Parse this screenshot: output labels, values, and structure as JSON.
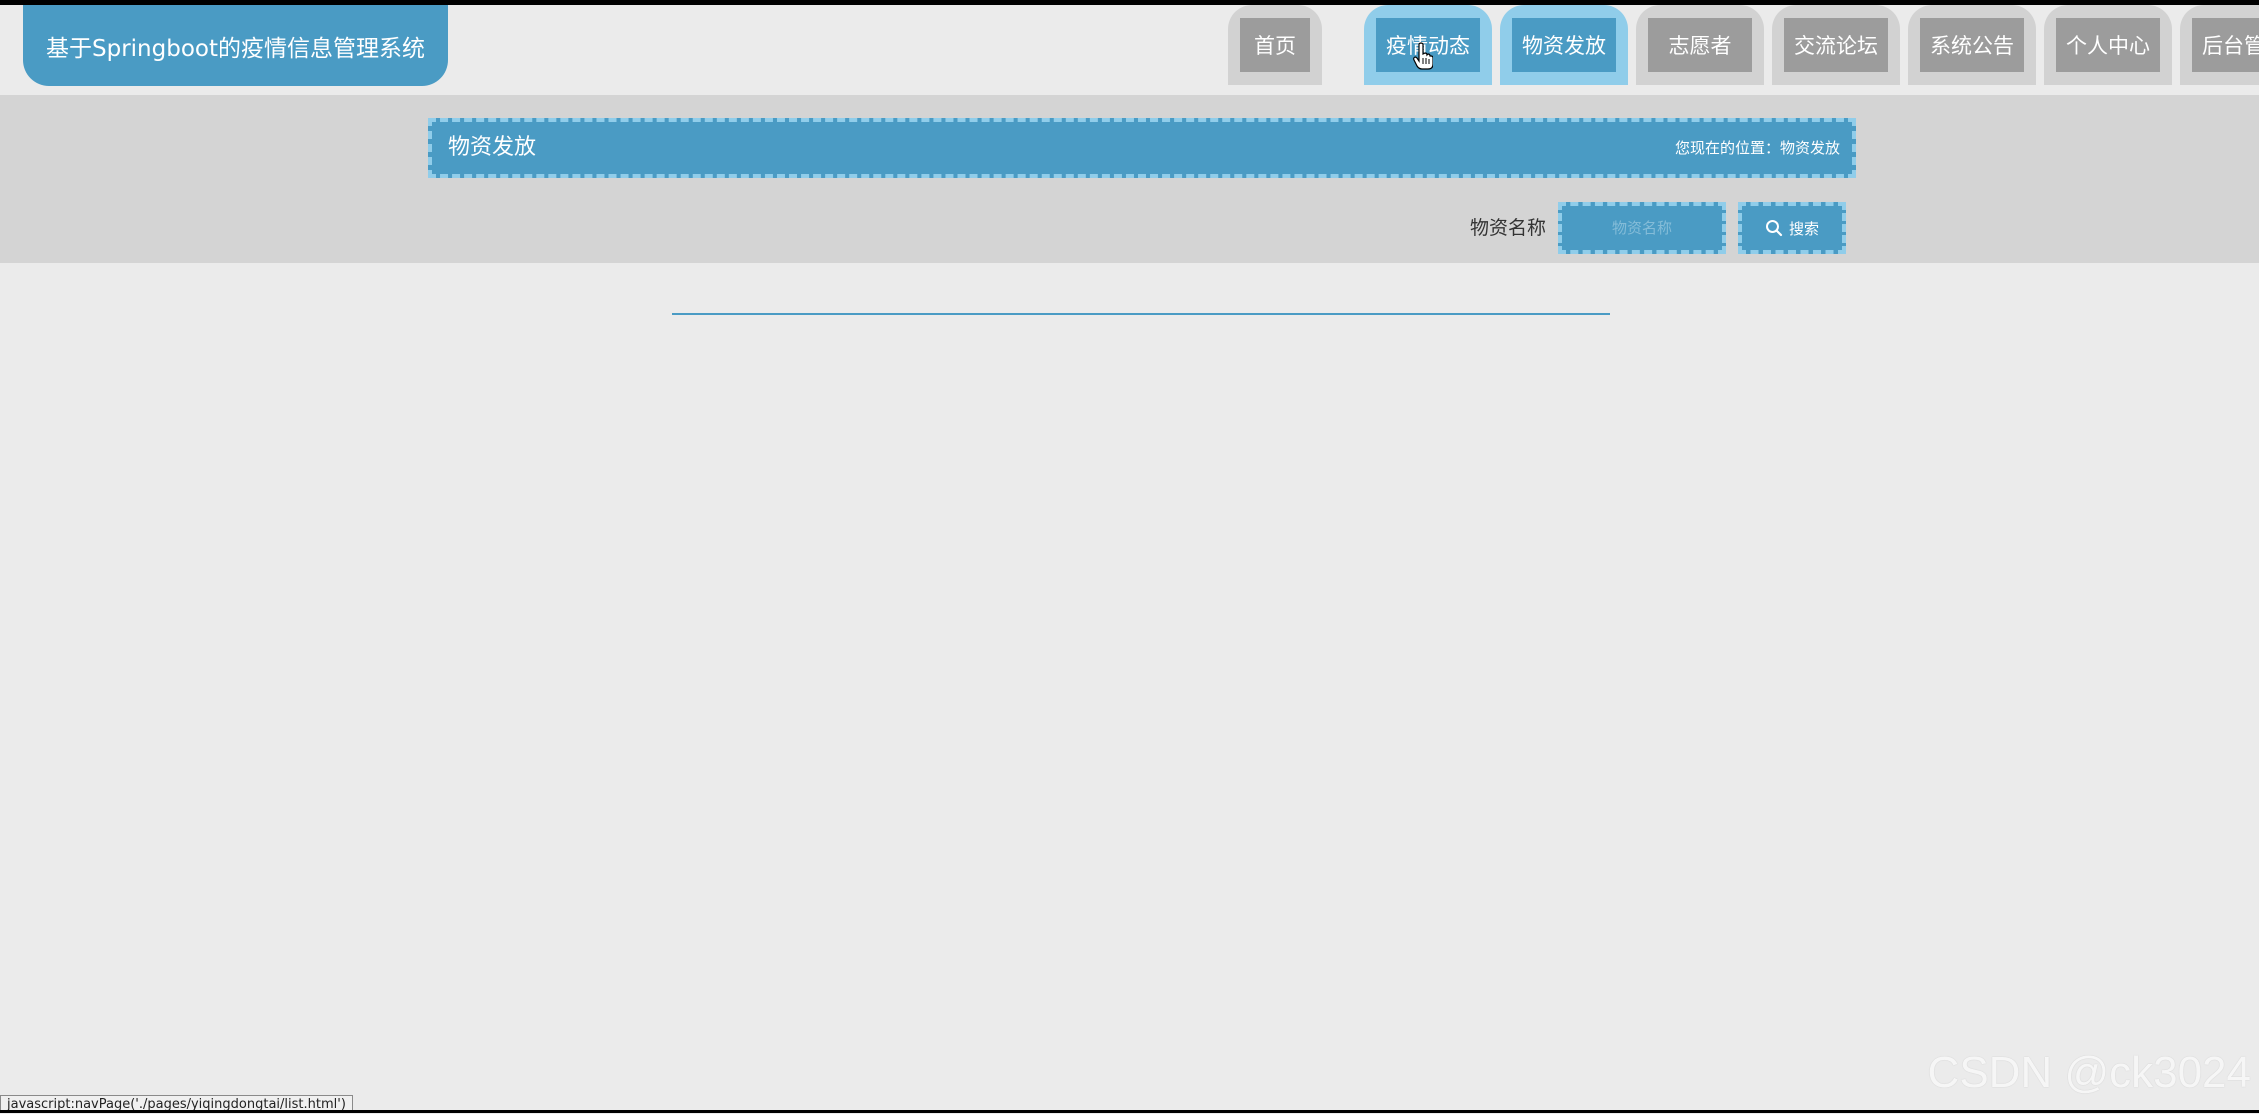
{
  "app": {
    "title": "基于Springboot的疫情信息管理系统"
  },
  "nav": {
    "items": [
      {
        "label": "首页"
      },
      {
        "label": "疫情动态"
      },
      {
        "label": "物资发放"
      },
      {
        "label": "志愿者"
      },
      {
        "label": "交流论坛"
      },
      {
        "label": "系统公告"
      },
      {
        "label": "个人中心"
      },
      {
        "label": "后台管理"
      }
    ],
    "active_label": "物资发放",
    "hover_label": "疫情动态"
  },
  "page": {
    "title": "物资发放",
    "breadcrumb": "您现在的位置：物资发放"
  },
  "search": {
    "label": "物资名称",
    "placeholder": "物资名称",
    "value": "",
    "button_label": "搜索"
  },
  "status_bar": {
    "link": "javascript:navPage('./pages/yiqingdongtai/list.html')"
  },
  "watermark": "CSDN @ck3024",
  "colors": {
    "primary": "#4a9bc4",
    "primary_light": "#90cdea",
    "tab_gray": "#9c9c9c",
    "background": "#ebebeb",
    "band": "#d4d4d4"
  }
}
